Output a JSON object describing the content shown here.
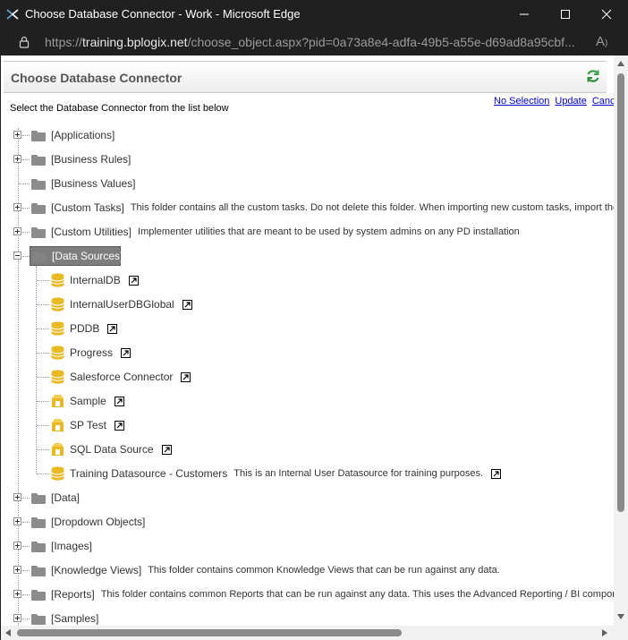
{
  "window": {
    "title": "Choose Database Connector - Work - Microsoft Edge",
    "app_icon": "edge-work-icon"
  },
  "address": {
    "prefix": "https://",
    "host": "training.bplogix.net",
    "path": "/choose_object.aspx?pid=0a73a8e4-adfa-49b5-a55e-d69ad8a95cbf..."
  },
  "dialog": {
    "title": "Choose Database Connector",
    "instructions": "Select the Database Connector from the list below",
    "links": {
      "no_selection": "No Selection",
      "update": "Update",
      "cancel": "Cancel"
    }
  },
  "tree": {
    "folders_before": [
      {
        "label": "[Applications]",
        "desc": ""
      },
      {
        "label": "[Business Rules]",
        "desc": ""
      },
      {
        "label": "[Business Values]",
        "desc": ""
      },
      {
        "label": "[Custom Tasks]",
        "desc": "This folder contains all the custom tasks. Do not delete this folder. When importing new custom tasks, import them fr"
      },
      {
        "label": "[Custom Utilities]",
        "desc": "Implementer utilities that are meant to be used by system admins on any PD installation"
      }
    ],
    "selected_folder": {
      "label": "[Data Sources]"
    },
    "children": [
      {
        "label": "InternalDB",
        "desc": "",
        "icon": "database-icon"
      },
      {
        "label": "InternalUserDBGlobal",
        "desc": "",
        "icon": "database-icon"
      },
      {
        "label": "PDDB",
        "desc": "",
        "icon": "database-icon"
      },
      {
        "label": "Progress",
        "desc": "",
        "icon": "database-icon"
      },
      {
        "label": "Salesforce Connector",
        "desc": "",
        "icon": "database-icon"
      },
      {
        "label": "Sample",
        "desc": "",
        "icon": "datasource-icon"
      },
      {
        "label": "SP Test",
        "desc": "",
        "icon": "datasource-icon"
      },
      {
        "label": "SQL Data Source",
        "desc": "",
        "icon": "datasource-icon"
      },
      {
        "label": "Training Datasource - Customers",
        "desc": "This is an Internal User Datasource for training purposes.",
        "icon": "database-icon"
      }
    ],
    "folders_after": [
      {
        "label": "[Data]",
        "desc": ""
      },
      {
        "label": "[Dropdown Objects]",
        "desc": ""
      },
      {
        "label": "[Images]",
        "desc": ""
      },
      {
        "label": "[Knowledge Views]",
        "desc": "This folder contains common Knowledge Views that can be run against any data."
      },
      {
        "label": "[Reports]",
        "desc": "This folder contains common Reports that can be run against any data. This uses the Advanced Reporting / BI component."
      },
      {
        "label": "[Samples]",
        "desc": ""
      }
    ]
  },
  "colors": {
    "folder": "#8c8c8c",
    "database": "#e8b923",
    "link": "#0000cc",
    "selected": "#7d7d7d"
  }
}
